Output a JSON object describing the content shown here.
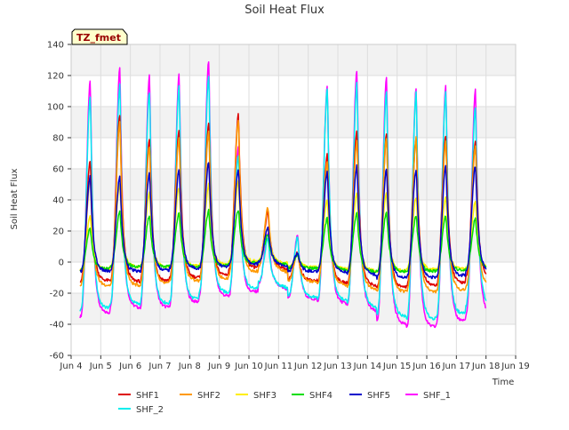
{
  "chart_data": {
    "type": "line",
    "title": "Soil Heat Flux",
    "xlabel": "Time",
    "ylabel": "Soil Heat Flux",
    "ylim": [
      -60,
      140
    ],
    "xlim": [
      4,
      19
    ],
    "grid": true,
    "legend_position": "bottom",
    "annotation": "TZ_fmet",
    "x_ticks": [
      {
        "value": 4,
        "label": "Jun 4"
      },
      {
        "value": 5,
        "label": "Jun 5"
      },
      {
        "value": 6,
        "label": "Jun 6"
      },
      {
        "value": 7,
        "label": "Jun 7"
      },
      {
        "value": 8,
        "label": "Jun 8"
      },
      {
        "value": 9,
        "label": "Jun 9"
      },
      {
        "value": 10,
        "label": "Jun 10"
      },
      {
        "value": 11,
        "label": "Jun 11"
      },
      {
        "value": 12,
        "label": "Jun 12"
      },
      {
        "value": 13,
        "label": "Jun 13"
      },
      {
        "value": 14,
        "label": "Jun 14"
      },
      {
        "value": 15,
        "label": "Jun 15"
      },
      {
        "value": 16,
        "label": "Jun 16"
      },
      {
        "value": 17,
        "label": "Jun 17"
      },
      {
        "value": 18,
        "label": "Jun 18"
      },
      {
        "value": 19,
        "label": "Jun 19"
      }
    ],
    "y_ticks": [
      -60,
      -40,
      -20,
      0,
      20,
      40,
      60,
      80,
      100,
      120,
      140
    ],
    "days": [
      4.3,
      5.3,
      6.3,
      7.3,
      8.3,
      9.3,
      10.3,
      11.3,
      12.3,
      13.3,
      14.3,
      15.3,
      16.3,
      17.3
    ],
    "series": [
      {
        "name": "SHF1",
        "color": "#dd0000",
        "order": 2,
        "peaks": [
          65,
          95,
          80,
          85,
          90,
          95,
          32,
          6,
          70,
          85,
          82,
          80,
          82,
          78
        ],
        "troughs": [
          -12,
          -12,
          -13,
          -10,
          -10,
          -5,
          -1,
          -11,
          -13,
          -14,
          -17,
          -15,
          -15,
          -10
        ]
      },
      {
        "name": "SHF2",
        "color": "#ff9900",
        "order": 3,
        "peaks": [
          55,
          90,
          75,
          80,
          85,
          92,
          35,
          6,
          65,
          78,
          80,
          80,
          78,
          75
        ],
        "troughs": [
          -15,
          -15,
          -15,
          -12,
          -12,
          -8,
          -3,
          -12,
          -14,
          -16,
          -19,
          -19,
          -19,
          -16
        ]
      },
      {
        "name": "SHF3",
        "color": "#ffee00",
        "order": 4,
        "peaks": [
          30,
          50,
          45,
          48,
          50,
          52,
          22,
          5,
          40,
          45,
          45,
          42,
          42,
          40
        ],
        "troughs": [
          -5,
          -3,
          -3,
          -3,
          -2,
          0,
          1,
          -3,
          -4,
          -5,
          -6,
          -5,
          -5,
          -4
        ]
      },
      {
        "name": "SHF4",
        "color": "#00dd00",
        "order": 5,
        "peaks": [
          22,
          32,
          30,
          32,
          33,
          34,
          18,
          5,
          28,
          32,
          32,
          30,
          30,
          28
        ],
        "troughs": [
          -5,
          -3,
          -3,
          -3,
          -3,
          -1,
          0,
          -4,
          -4,
          -6,
          -6,
          -6,
          -6,
          -4
        ]
      },
      {
        "name": "SHF5",
        "color": "#0000cc",
        "order": 6,
        "peaks": [
          55,
          55,
          58,
          60,
          65,
          60,
          22,
          6,
          58,
          62,
          60,
          60,
          62,
          62
        ],
        "troughs": [
          -6,
          -6,
          -6,
          -4,
          -4,
          -2,
          0,
          -6,
          -6,
          -7,
          -10,
          -10,
          -10,
          -6
        ]
      },
      {
        "name": "SHF_1",
        "color": "#ff00ff",
        "order": 0,
        "peaks": [
          117,
          126,
          120,
          121,
          130,
          75,
          19,
          18,
          113,
          124,
          120,
          112,
          114,
          111
        ],
        "troughs": [
          -35,
          -29,
          -30,
          -28,
          -22,
          -22,
          -14,
          -23,
          -26,
          -28,
          -38,
          -43,
          -40,
          -34
        ]
      },
      {
        "name": "SHF_2",
        "color": "#00eeee",
        "order": 1,
        "peaks": [
          107,
          114,
          110,
          113,
          120,
          69,
          15,
          16,
          111,
          115,
          110,
          109,
          110,
          100
        ],
        "troughs": [
          -31,
          -27,
          -27,
          -26,
          -20,
          -19,
          -13,
          -22,
          -24,
          -26,
          -34,
          -37,
          -36,
          -28
        ]
      }
    ]
  }
}
